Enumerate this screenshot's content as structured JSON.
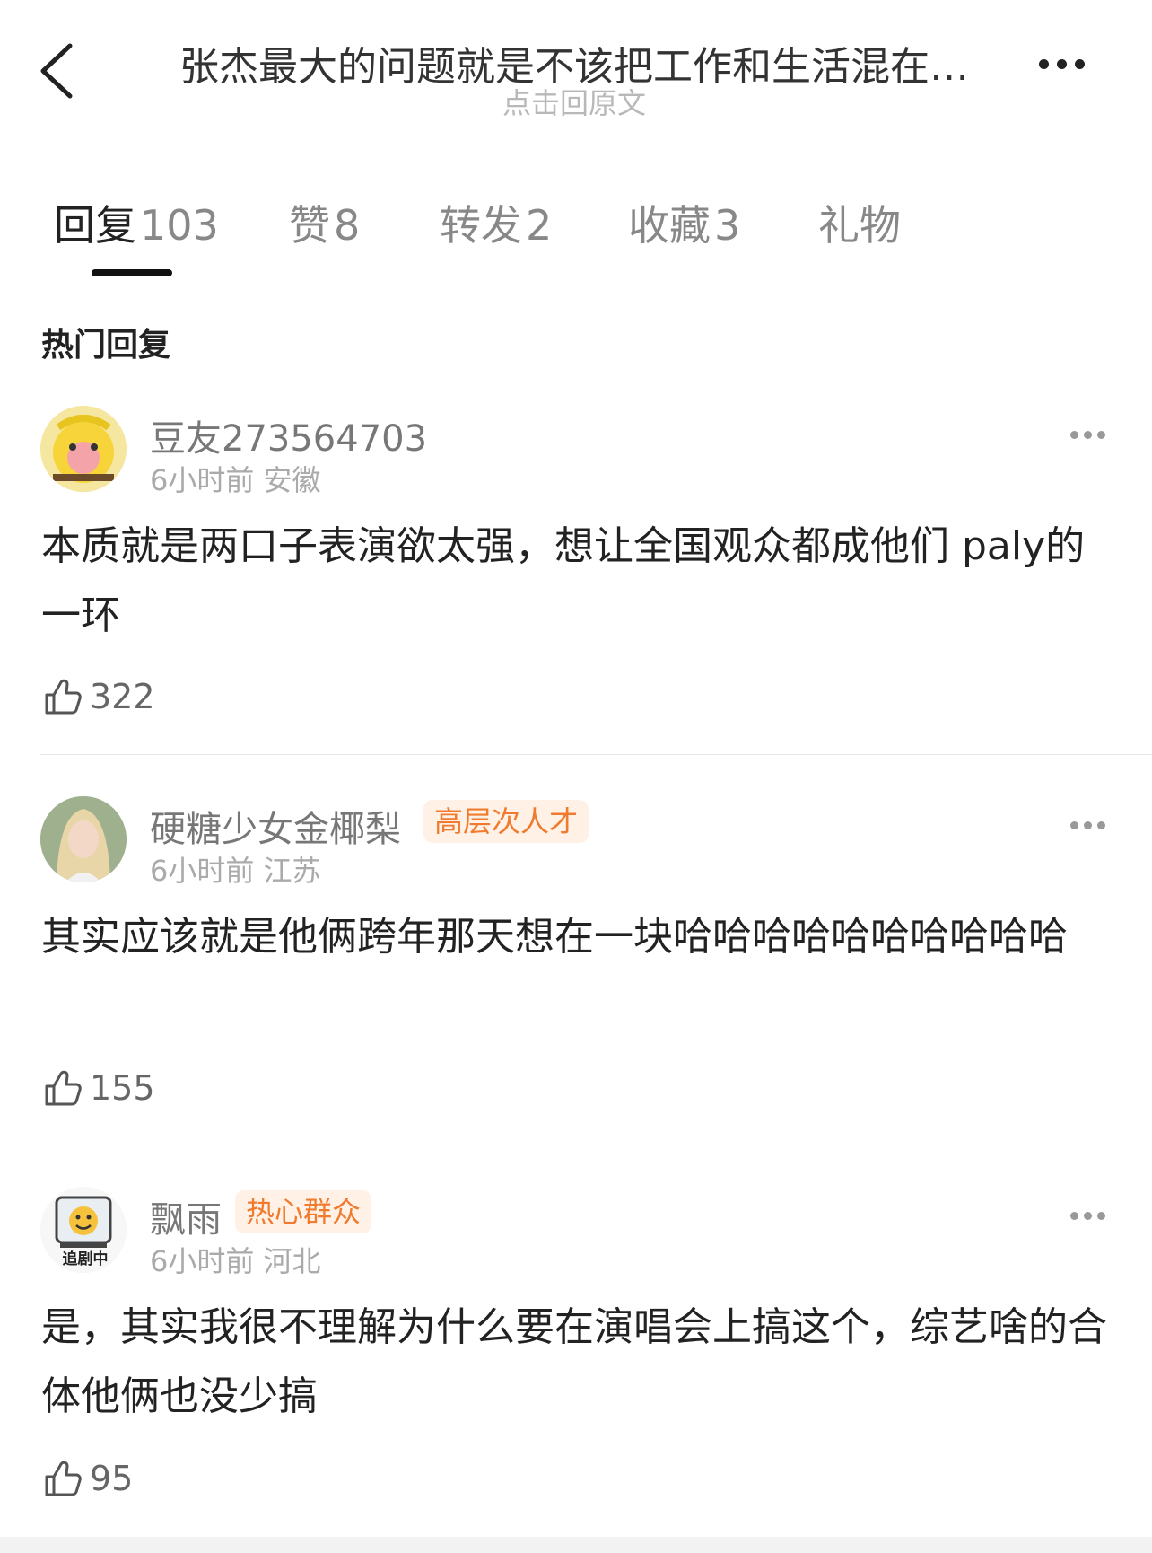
{
  "header": {
    "title": "张杰最大的问题就是不该把工作和生活混在…",
    "subtitle": "点击回原文"
  },
  "tabs": [
    {
      "label": "回复",
      "count": "103",
      "active": true
    },
    {
      "label": "赞",
      "count": "8",
      "active": false
    },
    {
      "label": "转发",
      "count": "2",
      "active": false
    },
    {
      "label": "收藏",
      "count": "3",
      "active": false
    },
    {
      "label": "礼物",
      "count": "",
      "active": false
    }
  ],
  "section_title": "热门回复",
  "comments": [
    {
      "username": "豆友273564703",
      "badge": "",
      "meta": "6小时前 安徽",
      "text": "本质就是两口子表演欲太强，想让全国观众都成他们 paly的一环",
      "likes": "322",
      "avatar_icon": "yellow-plush-avatar-icon"
    },
    {
      "username": "硬糖少女金椰梨",
      "badge": "高层次人才",
      "meta": "6小时前 江苏",
      "text": "其实应该就是他俩跨年那天想在一块哈哈哈哈哈哈哈哈哈哈",
      "likes": "155",
      "avatar_icon": "portrait-avatar-icon"
    },
    {
      "username": "飘雨",
      "badge": "热心群众",
      "meta": "6小时前 河北",
      "text": "是，其实我很不理解为什么要在演唱会上搞这个，综艺啥的合体他俩也没少搞",
      "likes": "95",
      "avatar_icon": "tv-watching-avatar-icon",
      "avatar_caption": "追剧中"
    }
  ],
  "colors": {
    "badge_bg": "#fff1e6",
    "badge_text": "#f07b2e",
    "muted_text": "#888888"
  }
}
